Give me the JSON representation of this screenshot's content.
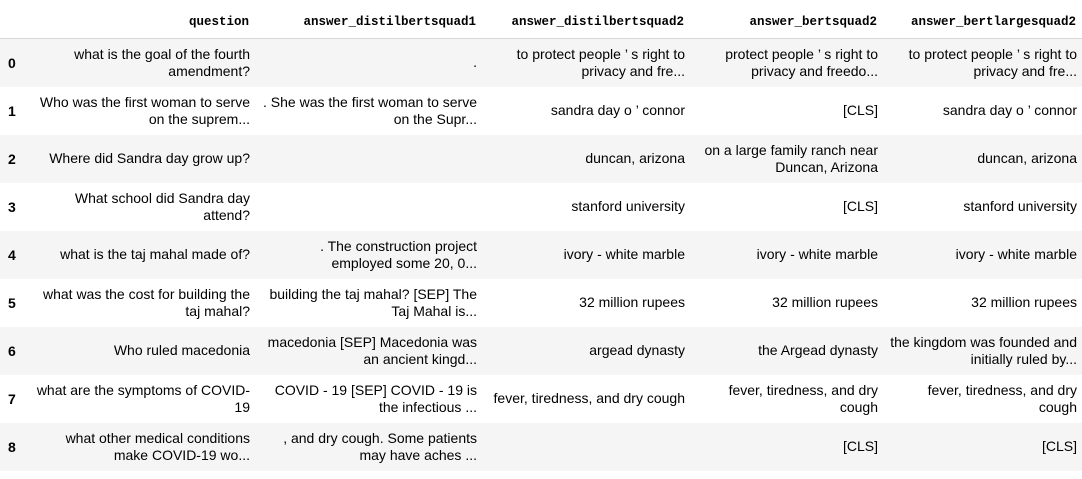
{
  "columns": [
    "question",
    "answer_distilbertsquad1",
    "answer_distilbertsquad2",
    "answer_bertsquad2",
    "answer_bertlargesquad2"
  ],
  "rows": [
    {
      "index": "0",
      "cells": [
        "what is the goal of the fourth amendment?",
        ".",
        "to protect people ’ s right to privacy and fre...",
        "protect people ’ s right to privacy and freedo...",
        "to protect people ’ s right to privacy and fre..."
      ]
    },
    {
      "index": "1",
      "cells": [
        "Who was the first woman to serve on the suprem...",
        ". She was the first woman to serve on the Supr...",
        "sandra day o ’ connor",
        "[CLS]",
        "sandra day o ’ connor"
      ]
    },
    {
      "index": "2",
      "cells": [
        "Where did Sandra day grow up?",
        "",
        "duncan, arizona",
        "on a large family ranch near Duncan, Arizona",
        "duncan, arizona"
      ]
    },
    {
      "index": "3",
      "cells": [
        "What school did Sandra day attend?",
        "",
        "stanford university",
        "[CLS]",
        "stanford university"
      ]
    },
    {
      "index": "4",
      "cells": [
        "what is the taj mahal made of?",
        ". The construction project employed some 20, 0...",
        "ivory - white marble",
        "ivory - white marble",
        "ivory - white marble"
      ]
    },
    {
      "index": "5",
      "cells": [
        "what was the cost for building the taj mahal?",
        "building the taj mahal? [SEP] The Taj Mahal is...",
        "32 million rupees",
        "32 million rupees",
        "32 million rupees"
      ]
    },
    {
      "index": "6",
      "cells": [
        "Who ruled macedonia",
        "macedonia [SEP] Macedonia was an ancient kingd...",
        "argead dynasty",
        "the Argead dynasty",
        "the kingdom was founded and initially ruled by..."
      ]
    },
    {
      "index": "7",
      "cells": [
        "what are the symptoms of COVID-19",
        "COVID - 19 [SEP] COVID - 19 is the infectious ...",
        "fever, tiredness, and dry cough",
        "fever, tiredness, and dry cough",
        "fever, tiredness, and dry cough"
      ]
    },
    {
      "index": "8",
      "cells": [
        "what other medical conditions make COVID-19 wo...",
        ", and dry cough. Some patients may have aches ...",
        "",
        "[CLS]",
        "[CLS]"
      ]
    }
  ]
}
